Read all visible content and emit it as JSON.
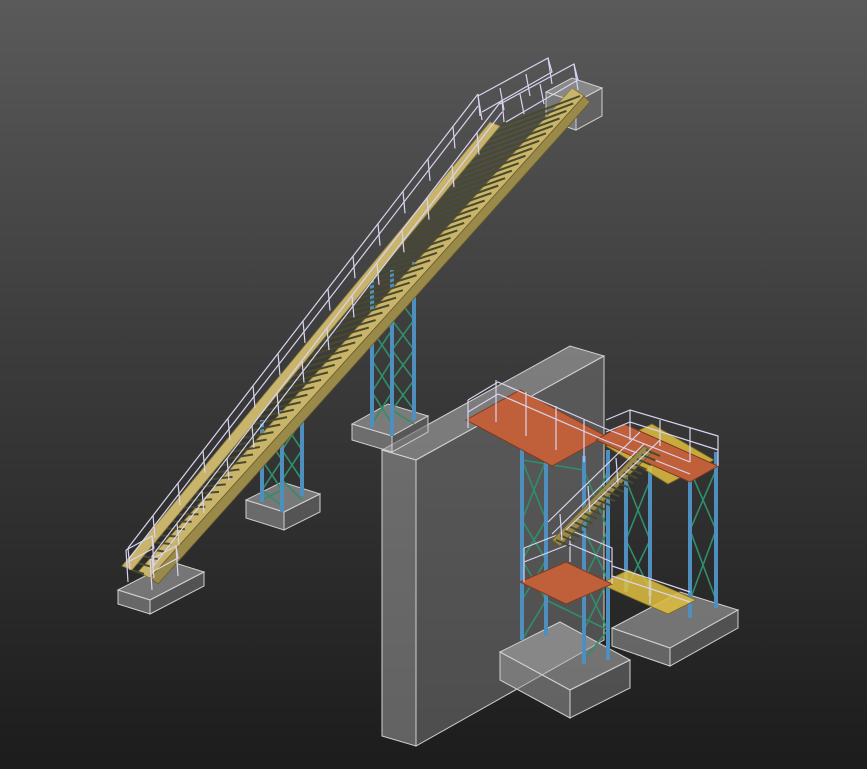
{
  "view": {
    "background_top": "#5a5a5a",
    "background_bottom": "#1c1c1c"
  },
  "colors": {
    "concrete_face": "#9a9a9a",
    "concrete_light": "#b4b4b4",
    "concrete_dark": "#6e6e6e",
    "concrete_edge": "#d0d0d0",
    "column": "#4e8fbf",
    "bracing": "#2e8f6a",
    "stringer": "#c8b46a",
    "tread": "#6a6a3a",
    "handrail": "#d8d4f0",
    "platform_deck": "#c0603a",
    "grating": "#e0c040"
  },
  "scene": {
    "objects": [
      {
        "name": "long-inclined-stair",
        "type": "stair"
      },
      {
        "name": "upper-landing-pier",
        "type": "concrete-pier"
      },
      {
        "name": "steel-tower-upper",
        "type": "support-tower"
      },
      {
        "name": "steel-tower-middle",
        "type": "support-tower"
      },
      {
        "name": "foundation-bottom",
        "type": "concrete-pad"
      },
      {
        "name": "concrete-wall",
        "type": "wall"
      },
      {
        "name": "platform-structure",
        "type": "platform"
      },
      {
        "name": "platform-stair",
        "type": "stair"
      }
    ]
  }
}
